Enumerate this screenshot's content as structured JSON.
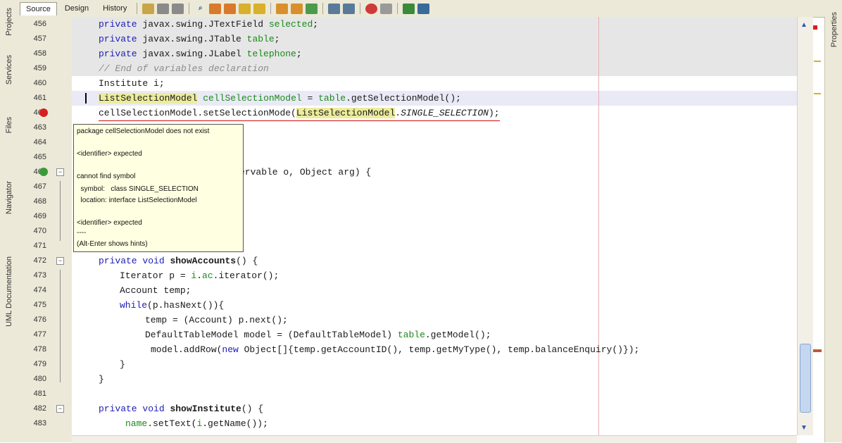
{
  "toolbar": {
    "tabs": [
      "Source",
      "Design",
      "History"
    ],
    "active_tab": "Source"
  },
  "left_rail": {
    "tabs": [
      "Projects",
      "Services",
      "Files",
      "Navigator",
      "UML Documentation"
    ]
  },
  "right_rail": {
    "tabs": [
      "Properties"
    ]
  },
  "colors": {
    "keyword": "#1c1cb8",
    "field": "#1a8a1a",
    "comment": "#8c8c8c",
    "error": "#d01010",
    "tooltip_bg": "#ffffe1"
  },
  "code_lines": [
    {
      "n": "456",
      "text": "private javax.swing.JTextField selected;"
    },
    {
      "n": "457",
      "text": "private javax.swing.JTable table;"
    },
    {
      "n": "458",
      "text": "private javax.swing.JLabel telephone;"
    },
    {
      "n": "459",
      "text": "// End of variables declaration"
    },
    {
      "n": "460",
      "text": "Institute i;"
    },
    {
      "n": "461",
      "text": "ListSelectionModel cellSelectionModel = table.getSelectionModel();"
    },
    {
      "n": "462",
      "text": "cellSelectionModel.setSelectionMode(ListSelectionModel.SINGLE_SELECTION);"
    },
    {
      "n": "463",
      "text": ""
    },
    {
      "n": "464",
      "text": ""
    },
    {
      "n": "465",
      "text": ""
    },
    {
      "n": "466",
      "text": "ervable o, Object arg) {"
    },
    {
      "n": "467",
      "text": ""
    },
    {
      "n": "468",
      "text": ""
    },
    {
      "n": "469",
      "text": ""
    },
    {
      "n": "470",
      "text": ""
    },
    {
      "n": "471",
      "text": ""
    },
    {
      "n": "472",
      "text": "private void showAccounts() {"
    },
    {
      "n": "473",
      "text": "Iterator p = i.ac.iterator();"
    },
    {
      "n": "474",
      "text": "Account temp;"
    },
    {
      "n": "475",
      "text": "while(p.hasNext()){"
    },
    {
      "n": "476",
      "text": "temp = (Account) p.next();"
    },
    {
      "n": "477",
      "text": "DefaultTableModel model = (DefaultTableModel) table.getModel();"
    },
    {
      "n": "478",
      "text": "model.addRow(new Object[]{temp.getAccountID(), temp.getMyType(), temp.balanceEnquiry()});"
    },
    {
      "n": "479",
      "text": "}"
    },
    {
      "n": "480",
      "text": "}"
    },
    {
      "n": "481",
      "text": ""
    },
    {
      "n": "482",
      "text": "private void showInstitute() {"
    },
    {
      "n": "483",
      "text": "name.setText(i.getName());"
    }
  ],
  "tooltip": {
    "line1": "package cellSelectionModel does not exist",
    "line2": "<identifier> expected",
    "line3": "cannot find symbol",
    "line4": "  symbol:   class SINGLE_SELECTION",
    "line5": "  location: interface ListSelectionModel",
    "line6": "<identifier> expected",
    "line7": "----",
    "line8": "(Alt-Enter shows hints)"
  }
}
